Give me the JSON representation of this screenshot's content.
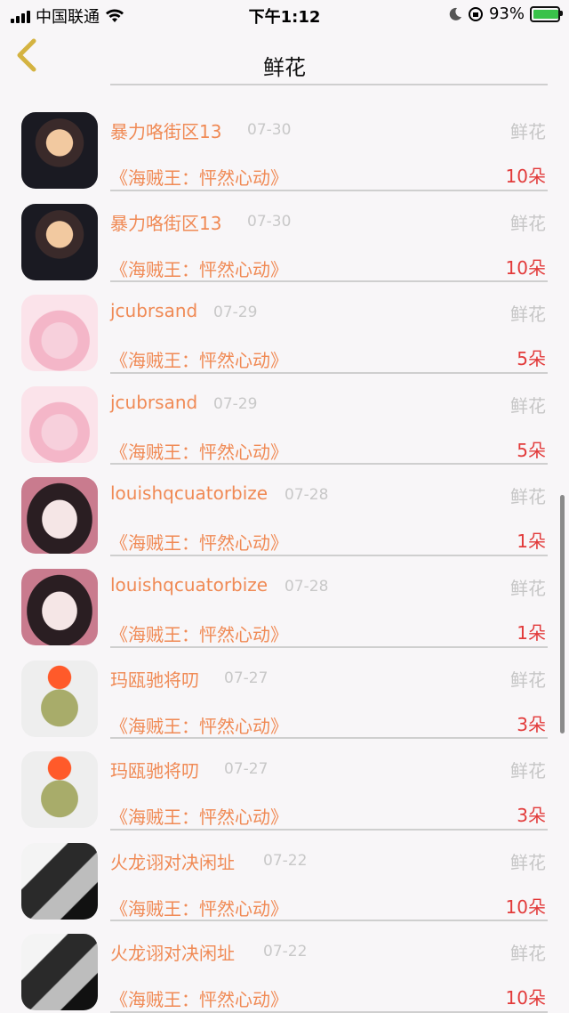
{
  "status_bar": {
    "carrier": "中国联通",
    "time": "下午1:12",
    "battery_percent": "93%"
  },
  "nav": {
    "title": "鲜花"
  },
  "records": [
    {
      "name": "暴力咯街区13",
      "date": "07-30",
      "type": "鲜花",
      "book": "《海贼王：怦然心动》",
      "count": "10朵"
    },
    {
      "name": "暴力咯街区13",
      "date": "07-30",
      "type": "鲜花",
      "book": "《海贼王：怦然心动》",
      "count": "10朵"
    },
    {
      "name": "jcubrsand",
      "date": "07-29",
      "type": "鲜花",
      "book": "《海贼王：怦然心动》",
      "count": "5朵"
    },
    {
      "name": "jcubrsand",
      "date": "07-29",
      "type": "鲜花",
      "book": "《海贼王：怦然心动》",
      "count": "5朵"
    },
    {
      "name": "louishqcuatorbize",
      "date": "07-28",
      "type": "鲜花",
      "book": "《海贼王：怦然心动》",
      "count": "1朵"
    },
    {
      "name": "louishqcuatorbize",
      "date": "07-28",
      "type": "鲜花",
      "book": "《海贼王：怦然心动》",
      "count": "1朵"
    },
    {
      "name": "玛瓯驰将叨",
      "date": "07-27",
      "type": "鲜花",
      "book": "《海贼王：怦然心动》",
      "count": "3朵"
    },
    {
      "name": "玛瓯驰将叨",
      "date": "07-27",
      "type": "鲜花",
      "book": "《海贼王：怦然心动》",
      "count": "3朵"
    },
    {
      "name": "火龙诩对决闲址",
      "date": "07-22",
      "type": "鲜花",
      "book": "《海贼王：怦然心动》",
      "count": "10朵"
    },
    {
      "name": "火龙诩对决闲址",
      "date": "07-22",
      "type": "鲜花",
      "book": "《海贼王：怦然心动》",
      "count": "10朵"
    }
  ]
}
